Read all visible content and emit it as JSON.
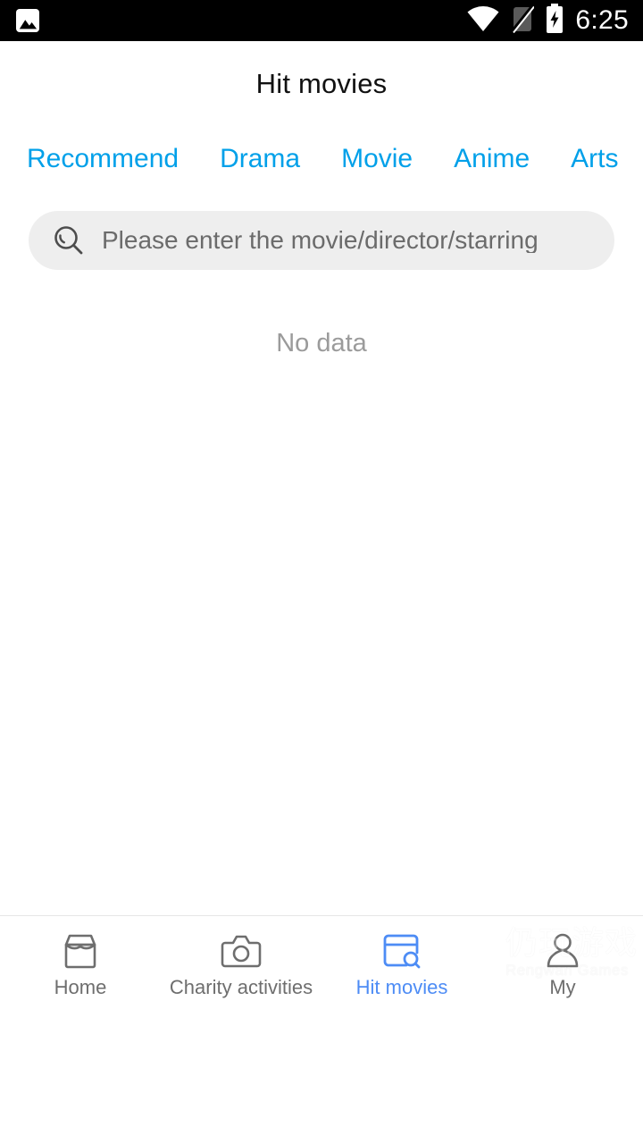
{
  "status_bar": {
    "notification_icon": "photo-icon",
    "wifi_icon": "wifi-icon",
    "sim_icon": "no-sim-icon",
    "battery_icon": "battery-charging-icon",
    "time": "6:25"
  },
  "header": {
    "title": "Hit movies"
  },
  "tabs": [
    {
      "label": "Recommend"
    },
    {
      "label": "Drama"
    },
    {
      "label": "Movie"
    },
    {
      "label": "Anime"
    },
    {
      "label": "Arts"
    }
  ],
  "search": {
    "icon": "search-icon",
    "value": "",
    "placeholder": "Please enter the movie/director/starring"
  },
  "content": {
    "empty_text": "No data"
  },
  "bottom_nav": [
    {
      "label": "Home",
      "icon": "store-icon",
      "active": false
    },
    {
      "label": "Charity activities",
      "icon": "camera-icon",
      "active": false
    },
    {
      "label": "Hit movies",
      "icon": "window-search-icon",
      "active": true
    },
    {
      "label": "My",
      "icon": "user-icon",
      "active": false
    }
  ],
  "watermark": {
    "logo": "rengwan-logo-icon",
    "text_cn": "仍玩游戏",
    "text_en": "Rengwan Games"
  },
  "colors": {
    "tab_blue": "#00a0e9",
    "nav_active_blue": "#4d8cf5",
    "search_bg": "#eeeeee",
    "muted_text": "#9b9b9b",
    "status_bg": "#000000"
  }
}
